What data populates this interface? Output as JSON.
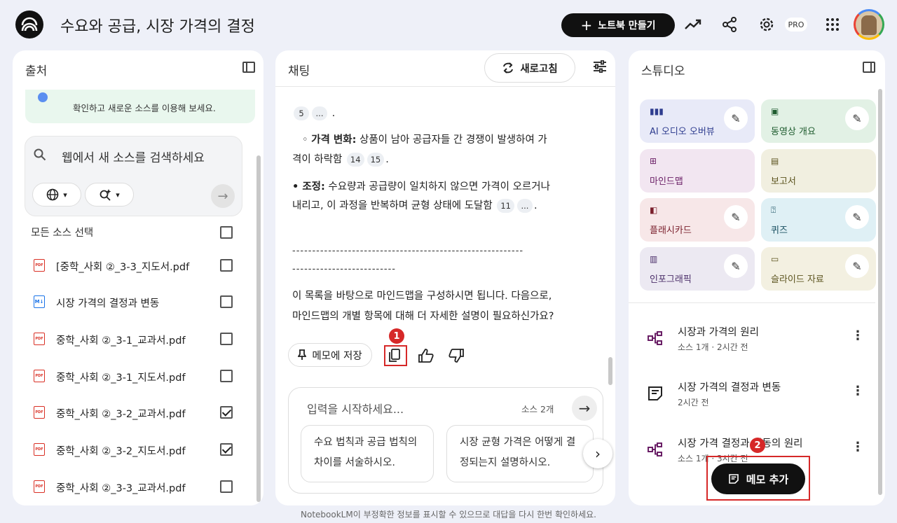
{
  "header": {
    "title": "수요와 공급, 시장 가격의 결정",
    "new_notebook": "노트북 만들기",
    "pro_badge": "PRO"
  },
  "sources": {
    "title": "출처",
    "banner_text": "확인하고 새로운 소스를 이용해 보세요.",
    "web_search_placeholder": "웹에서 새 소스를 검색하세요",
    "select_all": "모든 소스 선택",
    "items": [
      {
        "label": "[중학_사회 ②_3-3_지도서.pdf",
        "type": "PDF",
        "checked": false
      },
      {
        "label": "시장 가격의 결정과 변동",
        "type": "M↓",
        "checked": false
      },
      {
        "label": "중학_사회 ②_3-1_교과서.pdf",
        "type": "PDF",
        "checked": false
      },
      {
        "label": "중학_사회 ②_3-1_지도서.pdf",
        "type": "PDF",
        "checked": false
      },
      {
        "label": "중학_사회 ②_3-2_교과서.pdf",
        "type": "PDF",
        "checked": true
      },
      {
        "label": "중학_사회 ②_3-2_지도서.pdf",
        "type": "PDF",
        "checked": true
      },
      {
        "label": "중학_사회 ②_3-3_교과서.pdf",
        "type": "PDF",
        "checked": false
      }
    ]
  },
  "chat": {
    "title": "채팅",
    "refresh": "새로고침",
    "cite_a": "5",
    "cite_more": "...",
    "price_change_label": "가격 변화:",
    "price_change_text_1": "상품이 남아 공급자들 간 경쟁이 발생하여 가",
    "price_change_text_2": "격이 하락함",
    "cite_b": "14",
    "cite_c": "15",
    "adjust_label": "• 조정:",
    "adjust_text_1": "수요량과 공급량이 일치하지 않으면 가격이 오르거나",
    "adjust_text_2": "내리고, 이 과정을 반복하며 균형 상태에 도달함",
    "cite_d": "11",
    "dash_line_1": "----------------------------------------------------------",
    "dash_line_2": "--------------------------",
    "closing_1": "이 목록을 바탕으로 마인드맵을 구성하시면 됩니다. 다음으로,",
    "closing_2": "마인드맵의 개별 항목에 대해 더 자세한 설명이 필요하신가요?",
    "save_to_note": "메모에 저장",
    "marker_1": "1",
    "input_placeholder": "입력을 시작하세요...",
    "source_count": "소스 2개",
    "suggestions": [
      "수요 법칙과 공급 법칙의 차이를 서술하시오.",
      "시장 균형 가격은 어떻게 결정되는지 설명하시오."
    ]
  },
  "studio": {
    "title": "스튜디오",
    "tiles": [
      {
        "label": "AI 오디오 오버뷰",
        "bg": "#e8eaf8",
        "fg": "#2f3d8f",
        "icon": "audio-wave-icon"
      },
      {
        "label": "동영상 개요",
        "bg": "#e2f1e5",
        "fg": "#1e5b2e",
        "icon": "video-icon"
      },
      {
        "label": "마인드맵",
        "bg": "#f2e6f1",
        "fg": "#6a1f66",
        "icon": "mindmap-icon"
      },
      {
        "label": "보고서",
        "bg": "#f1efe0",
        "fg": "#5b531e",
        "icon": "report-icon"
      },
      {
        "label": "플래시카드",
        "bg": "#f7e7e8",
        "fg": "#7a1f2c",
        "icon": "flashcard-icon"
      },
      {
        "label": "퀴즈",
        "bg": "#dff0f5",
        "fg": "#174e5f",
        "icon": "quiz-icon"
      },
      {
        "label": "인포그래픽",
        "bg": "#ece9f2",
        "fg": "#4b2f6a",
        "icon": "infographic-icon"
      },
      {
        "label": "슬라이드 자료",
        "bg": "#f3f0e1",
        "fg": "#5b531e",
        "icon": "slides-icon"
      }
    ],
    "notes": [
      {
        "title": "시장과 가격의 원리",
        "sub": "소스 1개 · 2시간 전",
        "icon": "mindmap"
      },
      {
        "title": "시장 가격의 결정과 변동",
        "sub": "2시간 전",
        "icon": "note"
      },
      {
        "title": "시장 가격 결정과 변동의 원리",
        "sub": "소스 1개 · 3시간 전",
        "icon": "mindmap"
      }
    ],
    "add_memo": "메모 추가",
    "marker_2": "2"
  },
  "footer": "NotebookLM이 부정확한 정보를 표시할 수 있으므로 대답을 다시 한번 확인하세요.",
  "colors": {
    "accent_dark": "#111111",
    "annotation_red": "#d62828",
    "mindmap_purple": "#6a1f66"
  }
}
